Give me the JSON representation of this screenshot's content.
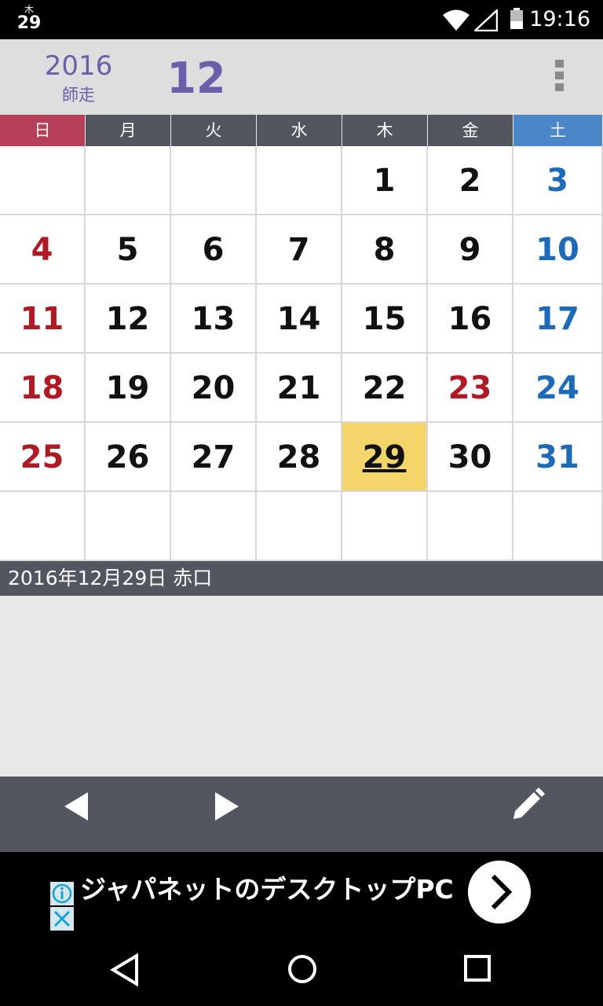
{
  "status_bar": {
    "date_dow": "木",
    "date_day": "29",
    "time": "19:16",
    "icons": [
      "wifi-icon",
      "signal-icon",
      "battery-icon"
    ]
  },
  "header": {
    "year": "2016",
    "month_name": "師走",
    "month": "12",
    "menu_icon": "overflow-menu-icon"
  },
  "calendar": {
    "weekdays": [
      "日",
      "月",
      "火",
      "水",
      "木",
      "金",
      "土"
    ],
    "weeks": [
      [
        "",
        "",
        "",
        "",
        "1",
        "2",
        "3"
      ],
      [
        "4",
        "5",
        "6",
        "7",
        "8",
        "9",
        "10"
      ],
      [
        "11",
        "12",
        "13",
        "14",
        "15",
        "16",
        "17"
      ],
      [
        "18",
        "19",
        "20",
        "21",
        "22",
        "23",
        "24"
      ],
      [
        "25",
        "26",
        "27",
        "28",
        "29",
        "30",
        "31"
      ],
      [
        "",
        "",
        "",
        "",
        "",
        "",
        ""
      ]
    ],
    "holidays": [
      "23"
    ],
    "today": "29",
    "colors": {
      "sunday": "#b01a24",
      "saturday": "#1d6ab8",
      "today_bg": "#f3d56a",
      "accent": "#6a5fa8"
    }
  },
  "selected_date": "2016年12月29日  赤口",
  "toolbar": {
    "prev_icon": "prev-month-icon",
    "next_icon": "next-month-icon",
    "edit_icon": "edit-pencil-icon"
  },
  "ad": {
    "text": "ジャパネットのデスクトップPC",
    "info_icon": "ad-info-icon",
    "close_icon": "ad-close-icon",
    "go_icon": "chevron-right-icon"
  },
  "nav_bar": {
    "icons": [
      "back-icon",
      "home-icon",
      "recent-apps-icon"
    ]
  }
}
